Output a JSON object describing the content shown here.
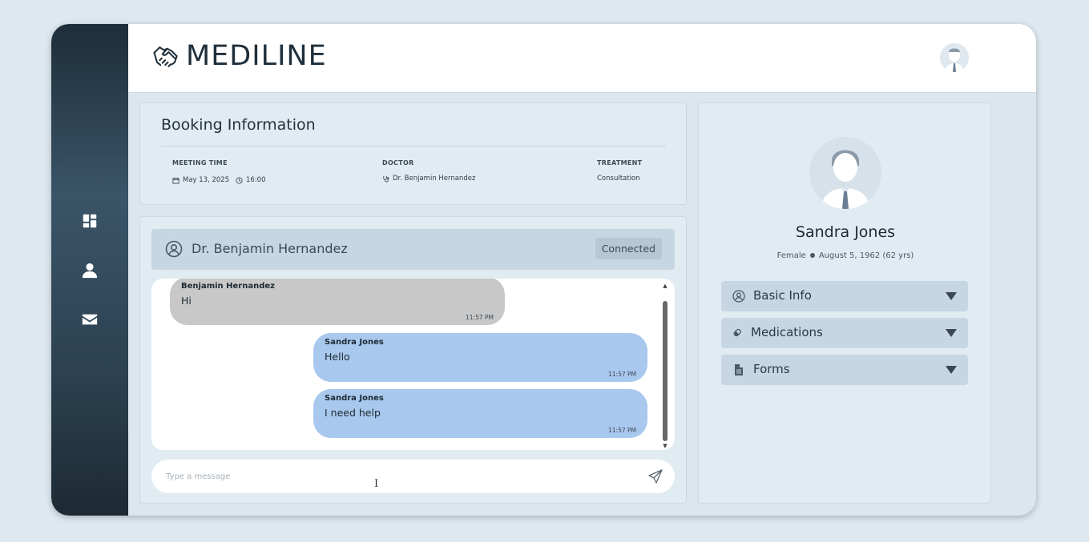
{
  "header": {
    "logo_text": "MEDILINE"
  },
  "sidebar": {
    "items": [
      {
        "name": "dashboard",
        "icon": "dashboard-icon"
      },
      {
        "name": "profile",
        "icon": "user-icon"
      },
      {
        "name": "messages",
        "icon": "mail-icon"
      }
    ]
  },
  "booking": {
    "title": "Booking Information",
    "meeting_time_label": "MEETING TIME",
    "date": "May 13, 2025",
    "time": "16:00",
    "doctor_label": "DOCTOR",
    "doctor_name": "Dr. Benjamin Hernandez",
    "treatment_label": "TREATMENT",
    "treatment": "Consultation"
  },
  "chat": {
    "contact_name": "Dr. Benjamin Hernandez",
    "status": "Connected",
    "messages": [
      {
        "sender": "Benjamin Hernandez",
        "text": "Hi",
        "time": "11:57 PM",
        "direction": "incoming"
      },
      {
        "sender": "Sandra Jones",
        "text": "Hello",
        "time": "11:57 PM",
        "direction": "outgoing"
      },
      {
        "sender": "Sandra Jones",
        "text": "I need help",
        "time": "11:57 PM",
        "direction": "outgoing"
      }
    ],
    "input_placeholder": "Type a message"
  },
  "patient": {
    "name": "Sandra Jones",
    "gender": "Female",
    "birth_info": "August 5, 1962 (62 yrs)",
    "sections": [
      {
        "label": "Basic Info",
        "icon": "user-circle-icon"
      },
      {
        "label": "Medications",
        "icon": "pill-icon"
      },
      {
        "label": "Forms",
        "icon": "document-icon"
      }
    ]
  },
  "colors": {
    "sidebar_dark": "#1e2e3a",
    "accent_blue": "#a8c8ee",
    "incoming_bubble": "#c8c8c8",
    "panel_bg": "#e1ebf2"
  }
}
